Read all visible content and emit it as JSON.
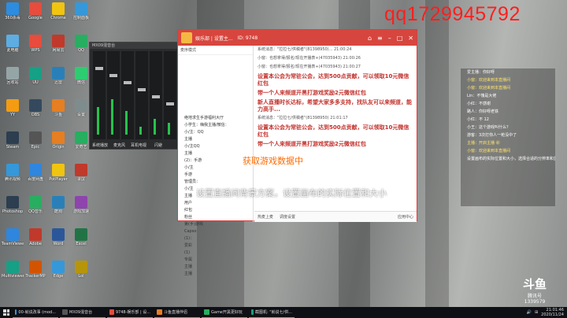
{
  "watermark": "qq1729945792",
  "overlay": {
    "loading_text": "获取游戏数据中",
    "bar_text": "设置直播间背景方案，设置画布的实际位置和大小"
  },
  "desktop_icons": [
    {
      "label": "360杀毒",
      "color": "#2c8de0"
    },
    {
      "label": "Google",
      "color": "#e74c3c"
    },
    {
      "label": "Chrome",
      "color": "#f1c40f"
    },
    {
      "label": "控制面板",
      "color": "#3498db"
    },
    {
      "label": "此电脑",
      "color": "#5dade2"
    },
    {
      "label": "WPS",
      "color": "#e74c3c"
    },
    {
      "label": "网易云",
      "color": "#c0392b"
    },
    {
      "label": "QQ",
      "color": "#27ae60"
    },
    {
      "label": "回收站",
      "color": "#95a5a6"
    },
    {
      "label": "UU",
      "color": "#16a085"
    },
    {
      "label": "迅雷",
      "color": "#2980b9"
    },
    {
      "label": "微信",
      "color": "#2ecc71"
    },
    {
      "label": "YY",
      "color": "#f39c12"
    },
    {
      "label": "OBS",
      "color": "#34495e"
    },
    {
      "label": "斗鱼",
      "color": "#e67e22"
    },
    {
      "label": "设置",
      "color": "#7f8c8d"
    },
    {
      "label": "Steam",
      "color": "#2c3e50"
    },
    {
      "label": "Epic",
      "color": "#555"
    },
    {
      "label": "Origin",
      "color": "#e67e22"
    },
    {
      "label": "爱奇艺",
      "color": "#27ae60"
    },
    {
      "label": "腾讯视频",
      "color": "#3498db"
    },
    {
      "label": "百度网盘",
      "color": "#2e86de"
    },
    {
      "label": "PotPlayer",
      "color": "#f1c40f"
    },
    {
      "label": "录屏",
      "color": "#c0392b"
    },
    {
      "label": "Photoshop",
      "color": "#2c3e50"
    },
    {
      "label": "QQ音乐",
      "color": "#27ae60"
    },
    {
      "label": "酷狗",
      "color": "#2980b9"
    },
    {
      "label": "游戏加速",
      "color": "#8e44ad"
    },
    {
      "label": "TeamViewer",
      "color": "#2e86de"
    },
    {
      "label": "Adobe",
      "color": "#c0392b"
    },
    {
      "label": "Word",
      "color": "#2b579a"
    },
    {
      "label": "Excel",
      "color": "#217346"
    },
    {
      "label": "Multiviewer",
      "color": "#16a085"
    },
    {
      "label": "TrackerMP",
      "color": "#d35400"
    },
    {
      "label": "Edge",
      "color": "#3498db"
    },
    {
      "label": "Lol",
      "color": "#b7950b"
    }
  ],
  "mixer": {
    "title": "MX09混音台",
    "labels": [
      "系统播放",
      "麦克风",
      "耳机电视",
      "闪避"
    ],
    "levels": [
      0.35,
      0.45,
      0.3,
      0.1,
      0.2,
      0.15
    ]
  },
  "room_window": {
    "title": "娱乐部 | 设置主...",
    "id_text": "ID: 9748",
    "mode_label": "麦序模式",
    "roster": [
      "绝地求生手游福利大厅",
      "小学生：嗨我主播/微信：",
      "小/主：QQ",
      "主播",
      "小/主QQ",
      "主播",
      "(2)：手游",
      "小/主",
      "手游",
      "管理员：",
      "小/主",
      "主播",
      "用户",
      "红包",
      "粉丝",
      "第(手)游戏",
      "Capso",
      "(1)：",
      "爱彩",
      "(1)",
      "专属",
      "主播",
      "主播"
    ],
    "chat": [
      {
        "kind": "sys",
        "text": "系统消息：\"拉拉七/供稿者\"(81398950)... 21:00:24"
      },
      {
        "kind": "sys",
        "text": "小窗：也想拿得/报名/现在开播表+(47035943) 21:00:26"
      },
      {
        "kind": "sys",
        "text": "小窗：也想拿得/报名/现在开播表+(47035943) 21:00:27"
      },
      {
        "kind": "notice",
        "text": "设置本公会为常驻公会，达到500点贡献，可以领取10元微信红包"
      },
      {
        "kind": "notice",
        "text": "带一个人来频道开黑打游戏奖励2元微信红包"
      },
      {
        "kind": "notice",
        "text": "新人直播时长达标，希望大家多多支持，找队友可以来频道，能力高手..."
      },
      {
        "kind": "sys",
        "text": "系统消息：\"拉拉七/供稿者\"(81398950) 21:01:17"
      },
      {
        "kind": "notice",
        "text": "设置本公会为常驻公会，达到500点贡献，可以领取10元微信红包"
      },
      {
        "kind": "notice",
        "text": "带一个人来频道开黑打游戏奖励2元微信红包"
      }
    ],
    "bottombar": [
      "热麦上麦",
      "调度设置",
      "应用中心"
    ]
  },
  "right_panel": [
    {
      "text": "爱主播：你好呀",
      "y": false
    },
    {
      "text": "小窗：欢迎来到本直播间",
      "y": true
    },
    {
      "text": "小窗：欢迎来到本直播间",
      "y": true
    },
    {
      "text": "Lin：不愧是大佬",
      "y": false
    },
    {
      "text": "小红：不感谢",
      "y": false
    },
    {
      "text": "路人：你好呀老铁",
      "y": false
    },
    {
      "text": "小红：不 12",
      "y": false
    },
    {
      "text": "小王：这个游戏叫什么？",
      "y": false
    },
    {
      "text": "游客：3次打你人一枪没中了",
      "y": false
    },
    {
      "text": "主播：开启主播 ㊗",
      "y": true
    },
    {
      "text": "小窗：欢迎来到本直播间",
      "y": true
    },
    {
      "text": "设置画布的实际位置和大小，选择合适的分辨率和显示器，画面，录音开播",
      "y": false
    }
  ],
  "logo": {
    "mark": "斗鱼",
    "sub": "腾讯号",
    "num": "1339579"
  },
  "taskbar": {
    "tasks": [
      {
        "label": "00-就说改事 (mod...",
        "color": "#3498db"
      },
      {
        "label": "MX09混音台",
        "color": "#555"
      },
      {
        "label": "9748-娱乐部 | 设...",
        "color": "#e74c3c"
      },
      {
        "label": "斗鱼直播伴侣",
        "color": "#e67e22"
      },
      {
        "label": "Game开黑更好玩",
        "color": "#27ae60"
      },
      {
        "label": "截图机: \"就说七/供...",
        "color": "#16a085"
      }
    ],
    "time": "21:01:46",
    "date": "2020/11/24"
  }
}
